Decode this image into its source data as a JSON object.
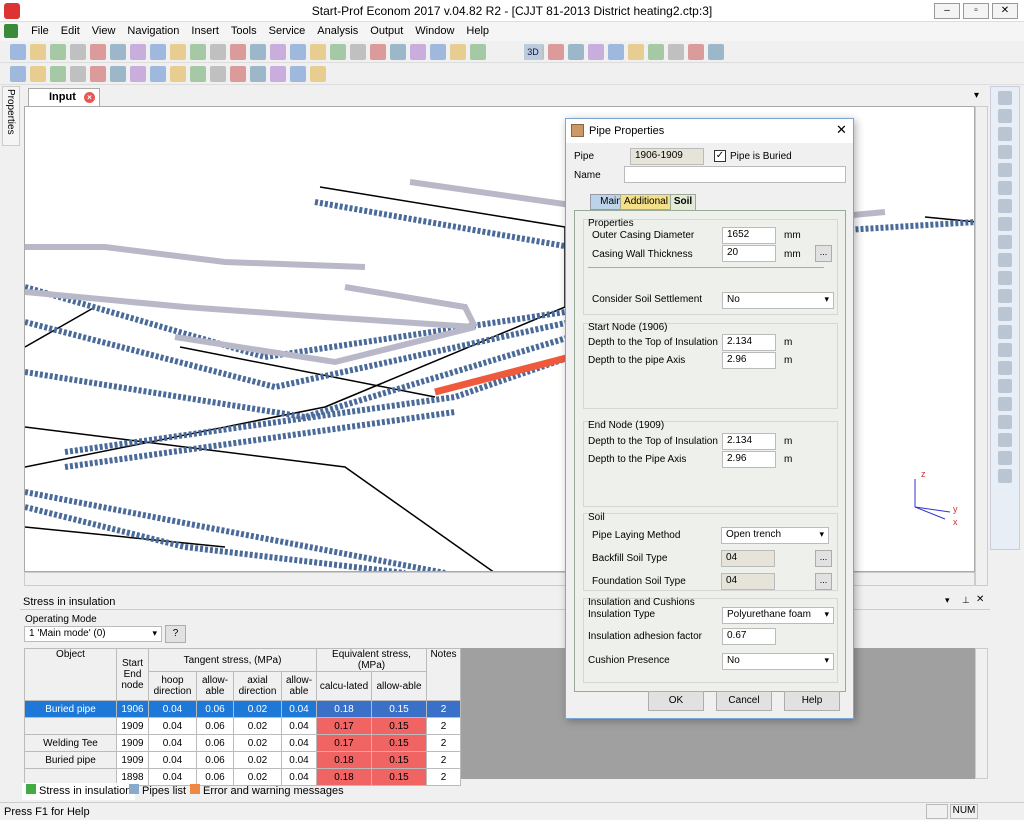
{
  "app": {
    "title": "Start-Prof Econom 2017 v.04.82 R2 - [CJJT 81-2013 District heating2.ctp:3]"
  },
  "menu": [
    "File",
    "Edit",
    "View",
    "Navigation",
    "Insert",
    "Tools",
    "Service",
    "Analysis",
    "Output",
    "Window",
    "Help"
  ],
  "side_panel": {
    "label": "Properties"
  },
  "doc_tab": {
    "label": "Input"
  },
  "toolbar": {
    "view3d": "3D"
  },
  "axes": {
    "z": "z",
    "y": "y",
    "x": "x"
  },
  "bottom_panel": {
    "title": "Stress in insulation",
    "operating_mode_label": "Operating Mode",
    "operating_mode_value": "1 'Main mode' (0)",
    "help_button": "?",
    "headers": {
      "object": "Object",
      "node": "Start End node",
      "tangent": "Tangent stress, (MPa)",
      "equivalent": "Equivalent stress, (MPa)",
      "notes": "Notes",
      "hoop": "hoop direction",
      "allow1": "allow-able",
      "axial": "axial direction",
      "allow2": "allow-able",
      "calc": "calcu-lated",
      "allow3": "allow-able"
    },
    "rows": [
      {
        "object": "Buried pipe",
        "node": "1906",
        "hoop": "0.04",
        "allow1": "0.06",
        "axial": "0.02",
        "allow2": "0.04",
        "calc": "0.18",
        "allow3": "0.15",
        "notes": "2",
        "selected": true
      },
      {
        "object": "",
        "node": "1909",
        "hoop": "0.04",
        "allow1": "0.06",
        "axial": "0.02",
        "allow2": "0.04",
        "calc": "0.17",
        "allow3": "0.15",
        "notes": "2"
      },
      {
        "object": "Welding Tee",
        "node": "1909",
        "hoop": "0.04",
        "allow1": "0.06",
        "axial": "0.02",
        "allow2": "0.04",
        "calc": "0.17",
        "allow3": "0.15",
        "notes": "2"
      },
      {
        "object": "Buried pipe",
        "node": "1909",
        "hoop": "0.04",
        "allow1": "0.06",
        "axial": "0.02",
        "allow2": "0.04",
        "calc": "0.18",
        "allow3": "0.15",
        "notes": "2"
      },
      {
        "object": "",
        "node": "1898",
        "hoop": "0.04",
        "allow1": "0.06",
        "axial": "0.02",
        "allow2": "0.04",
        "calc": "0.18",
        "allow3": "0.15",
        "notes": "2"
      }
    ],
    "tabs": [
      "Stress in insulation",
      "Pipes list",
      "Error and warning messages"
    ]
  },
  "status": {
    "help": "Press F1 for Help",
    "num": "NUM"
  },
  "dialog": {
    "title": "Pipe Properties",
    "pipe_label": "Pipe",
    "pipe_value": "1906-1909",
    "buried_label": "Pipe is Buried",
    "buried": true,
    "name_label": "Name",
    "name_value": "",
    "tabs": [
      "Main",
      "Additional",
      "Soil"
    ],
    "properties": {
      "title": "Properties",
      "outer_label": "Outer Casing Diameter",
      "outer_value": "1652",
      "outer_unit": "mm",
      "wall_label": "Casing Wall Thickness",
      "wall_value": "20",
      "wall_unit": "mm",
      "settle_label": "Consider Soil Settlement",
      "settle_value": "No"
    },
    "start_node": {
      "title": "Start Node (1906)",
      "top_label": "Depth to the Top of Insulation",
      "top_value": "2.134",
      "top_unit": "m",
      "axis_label": "Depth to the pipe Axis",
      "axis_value": "2.96",
      "axis_unit": "m"
    },
    "end_node": {
      "title": "End Node (1909)",
      "top_label": "Depth to the Top of Insulation",
      "top_value": "2.134",
      "top_unit": "m",
      "axis_label": "Depth to the Pipe Axis",
      "axis_value": "2.96",
      "axis_unit": "m"
    },
    "soil": {
      "title": "Soil",
      "method_label": "Pipe Laying Method",
      "method_value": "Open trench",
      "backfill_label": "Backfill Soil Type",
      "backfill_value": "04",
      "foundation_label": "Foundation Soil Type",
      "foundation_value": "04"
    },
    "insulation": {
      "title": "Insulation and Cushions",
      "type_label": "Insulation Type",
      "type_value": "Polyurethane foam",
      "adhesion_label": "Insulation adhesion factor",
      "adhesion_value": "0.67",
      "cushion_label": "Cushion Presence",
      "cushion_value": "No"
    },
    "ok": "OK",
    "cancel": "Cancel",
    "help": "Help",
    "browse": "..."
  },
  "colors": {
    "selection": "#1e78d7",
    "exceed": "#f06464",
    "pipe_blue": "#4a6a9a",
    "highlight_pipe": "#f05a3c"
  }
}
